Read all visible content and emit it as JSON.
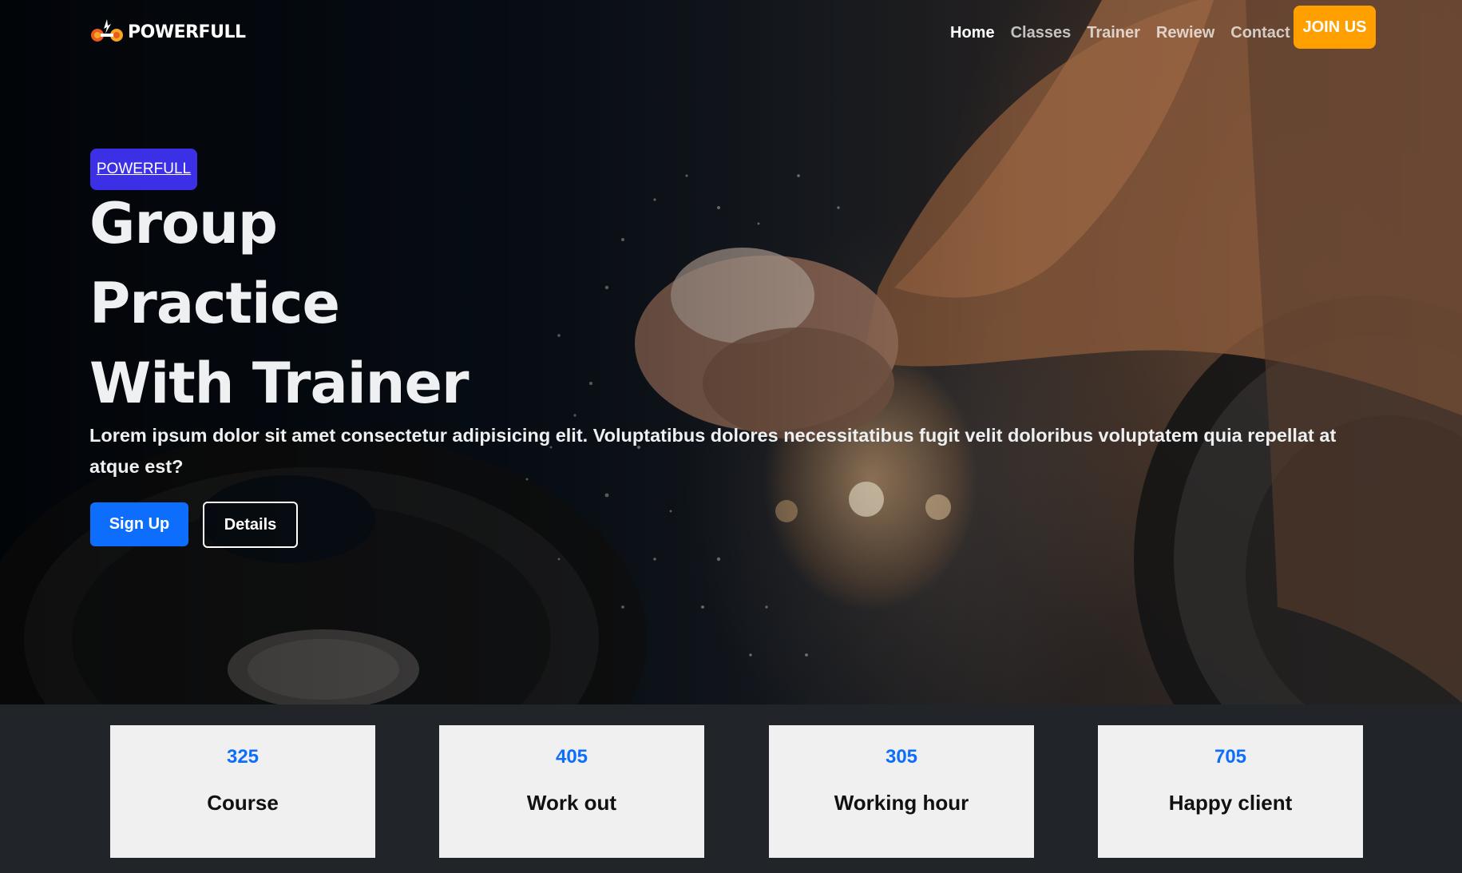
{
  "brand": {
    "name": "POWERFULL",
    "logo_icon": "dumbbell-flame-logo"
  },
  "nav": {
    "items": [
      {
        "label": "Home",
        "active": true
      },
      {
        "label": "Classes",
        "active": false
      },
      {
        "label": "Trainer",
        "active": false
      },
      {
        "label": "Rewiew",
        "active": false
      },
      {
        "label": "Contact",
        "active": false
      }
    ],
    "cta": "JOIN US"
  },
  "hero": {
    "badge": "POWERFULL",
    "headline": [
      "Group",
      "Practice",
      "With Trainer"
    ],
    "lead": "Lorem ipsum dolor sit amet consectetur adipisicing elit. Voluptatibus dolores necessitatibus fugit velit doloribus voluptatem quia repellat at atque est?",
    "primary_button": "Sign Up",
    "secondary_button": "Details",
    "background_image": "gym-athlete-chalk-hands-barbell"
  },
  "stats": [
    {
      "value": "325",
      "label": "Course"
    },
    {
      "value": "405",
      "label": "Work out"
    },
    {
      "value": "305",
      "label": "Working hour"
    },
    {
      "value": "705",
      "label": "Happy client"
    }
  ],
  "colors": {
    "join_button": "#ffa000",
    "badge": "#3b30e6",
    "primary": "#0d6efd",
    "stats_background": "#212529",
    "stat_card": "#f0f0f0"
  }
}
